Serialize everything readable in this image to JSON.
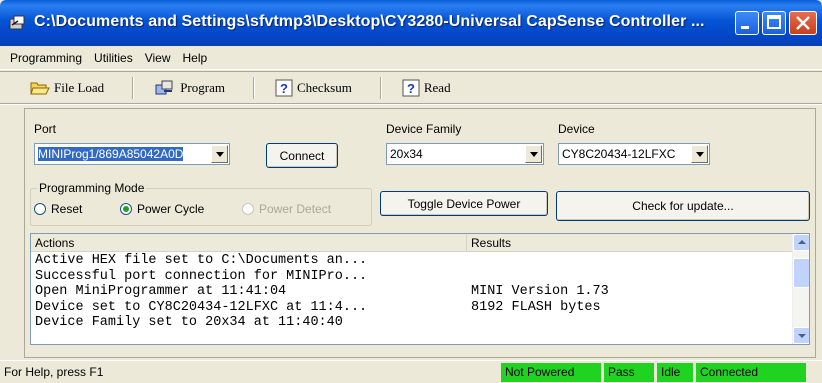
{
  "window": {
    "title": "C:\\Documents and Settings\\sfvtmp3\\Desktop\\CY3280-Universal CapSense Controller ..."
  },
  "menu": {
    "items": [
      "Programming",
      "Utilities",
      "View",
      "Help"
    ]
  },
  "toolbar": {
    "file_load": "File Load",
    "program": "Program",
    "checksum": "Checksum",
    "read": "Read"
  },
  "port": {
    "label": "Port",
    "value": "MINIProg1/869A85042A0D",
    "connect": "Connect"
  },
  "device_family": {
    "label": "Device Family",
    "value": "20x34"
  },
  "device": {
    "label": "Device",
    "value": "CY8C20434-12LFXC"
  },
  "programming_mode": {
    "title": "Programming Mode",
    "options": [
      {
        "label": "Reset",
        "selected": false,
        "enabled": true
      },
      {
        "label": "Power Cycle",
        "selected": true,
        "enabled": true
      },
      {
        "label": "Power Detect",
        "selected": false,
        "enabled": false
      }
    ]
  },
  "buttons": {
    "toggle_power": "Toggle Device Power",
    "check_update": "Check for update..."
  },
  "log": {
    "columns": [
      "Actions",
      "Results"
    ],
    "rows": [
      {
        "action": "Active HEX file set to C:\\Documents an...",
        "result": ""
      },
      {
        "action": "Successful port connection for MINIPro...",
        "result": ""
      },
      {
        "action": "Open MiniProgrammer at 11:41:04",
        "result": "MINI Version 1.73"
      },
      {
        "action": "Device set to CY8C20434-12LFXC at 11:4...",
        "result": "8192 FLASH bytes"
      },
      {
        "action": "Device Family set to 20x34 at 11:40:40",
        "result": ""
      }
    ]
  },
  "status": {
    "help": "For Help, press F1",
    "power": "Not Powered",
    "result": "Pass",
    "state": "Idle",
    "connection": "Connected",
    "indicator_color": "#21d321"
  }
}
